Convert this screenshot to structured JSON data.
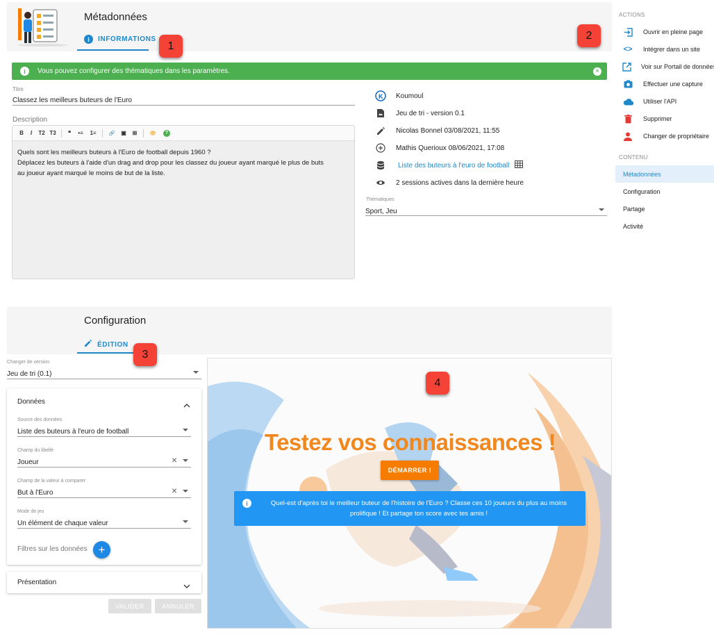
{
  "metadata": {
    "title": "Métadonnées",
    "tab_label": "INFORMATIONS",
    "badge1": "1",
    "badge2": "2",
    "alert": "Vous pouvez configurer des thématiques dans les paramètres.",
    "titre_label": "Titre",
    "titre_value": "Classez les meilleurs buteurs de l'Euro",
    "description_label": "Description",
    "toolbar": [
      "B",
      "I",
      "T2",
      "T3",
      "❝",
      "•≡",
      "1≡",
      "🔗",
      "▣",
      "⊞",
      "👁",
      "?"
    ],
    "description_lines": [
      "Quels sont les meilleurs buteurs à l'Euro de football depuis 1960 ?",
      "Déplacez les buteurs à l'aide d'un drag and drop pour les classez du joueur ayant marqué le plus de buts",
      "au joueur ayant marqué le moins de but de la liste."
    ],
    "info": {
      "owner": "Koumoul",
      "app": "Jeu de tri - version 0.1",
      "updated": "Nicolas Bonnel 03/08/2021, 11:55",
      "created": "Mathis Querioux 08/06/2021, 17:08",
      "dataset": "Liste des buteurs à l'euro de football",
      "sessions": "2 sessions actives dans la dernière heure"
    },
    "thematiques_label": "Thématiques",
    "thematiques_value": "Sport, Jeu"
  },
  "actions": {
    "section": "ACTIONS",
    "items": [
      "Ouvrir en pleine page",
      "Intégrer dans un site",
      "Voir sur Portail de données ...",
      "Effectuer une capture",
      "Utiliser l'API",
      "Supprimer",
      "Changer de propriétaire"
    ]
  },
  "contenu": {
    "section": "CONTENU",
    "items": [
      "Métadonnées",
      "Configuration",
      "Partage",
      "Activité"
    ]
  },
  "config": {
    "title": "Configuration",
    "tab_label": "ÉDITION",
    "badge3": "3",
    "badge4": "4",
    "version_label": "Changer de version",
    "version_value": "Jeu de tri (0.1)",
    "donnees_title": "Données",
    "source_label": "Source des données",
    "source_value": "Liste des buteurs à l'euro de football",
    "champ_libelle_label": "Champ du libellé",
    "champ_libelle_value": "Joueur",
    "champ_valeur_label": "Champ de la valeur à comparer",
    "champ_valeur_value": "But à l'Euro",
    "mode_label": "Mode de jeu",
    "mode_value": "Un élément de chaque valeur",
    "filtres_label": "Filtres sur les données",
    "presentation_title": "Présentation",
    "valider": "VALIDER",
    "annuler": "ANNULER"
  },
  "preview": {
    "headline": "Testez vos connaissances !",
    "start": "DÉMARRER !",
    "info_line1": "Quel-est d'après toi le meilleur buteur de l'histoire de l'Euro ? Classe ces 10 joueurs du plus au moins",
    "info_line2": "prolifique ! Et partage ton score avec tes amis !"
  }
}
